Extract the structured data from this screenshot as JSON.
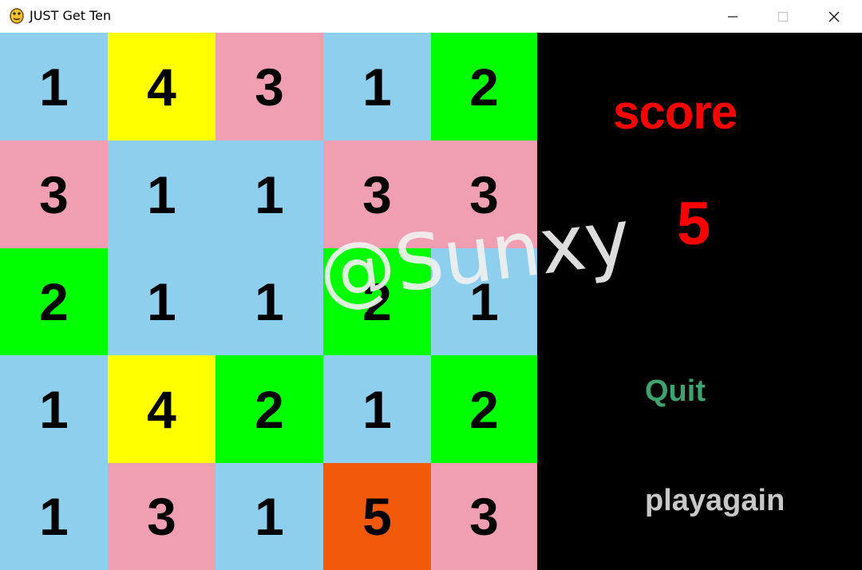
{
  "window": {
    "title": "JUST Get Ten",
    "icon": "pygame-snake-icon",
    "controls": [
      "minimize-icon",
      "maximize-icon",
      "close-icon"
    ]
  },
  "colors": {
    "1": "#8ecfee",
    "2": "#00ff00",
    "3": "#f09fb2",
    "4": "#ffff00",
    "5": "#f05a0a"
  },
  "board": {
    "rows": [
      [
        "1",
        "4",
        "3",
        "1",
        "2"
      ],
      [
        "3",
        "1",
        "1",
        "3",
        "3"
      ],
      [
        "2",
        "1",
        "1",
        "2",
        "1"
      ],
      [
        "1",
        "4",
        "2",
        "1",
        "2"
      ],
      [
        "1",
        "3",
        "1",
        "5",
        "3"
      ]
    ]
  },
  "panel": {
    "score_label": "score",
    "score_value": "5",
    "quit_label": "Quit",
    "again_label": "playagain"
  },
  "watermark": "@Sunxy"
}
